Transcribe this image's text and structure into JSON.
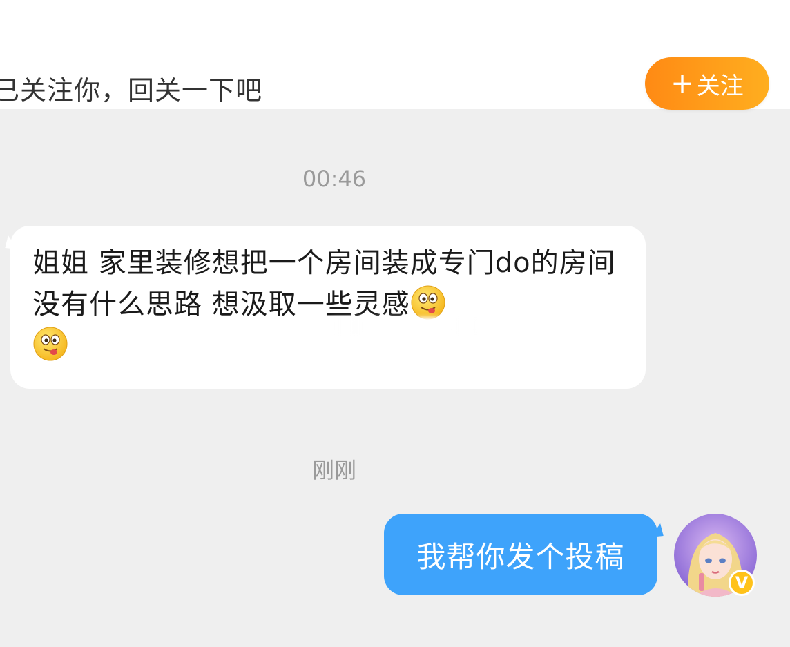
{
  "follow_bar": {
    "text": "已关注你，回关一下吧",
    "button_label": "关注",
    "button_icon": "plus-icon"
  },
  "messages": [
    {
      "timestamp": "00:46",
      "sender": "other",
      "text": "姐姐 家里装修想把一个房间装成专门do的房间 没有什么思路 想汲取一些灵感",
      "emoji": "tongue-out-emoji"
    },
    {
      "timestamp": "刚刚",
      "sender": "self",
      "text": "我帮你发个投稿"
    }
  ],
  "badge": {
    "label": "V"
  },
  "colors": {
    "accent": "#ff9a18",
    "self_bubble": "#3ea3fb",
    "other_bubble": "#ffffff",
    "background": "#efefef"
  }
}
